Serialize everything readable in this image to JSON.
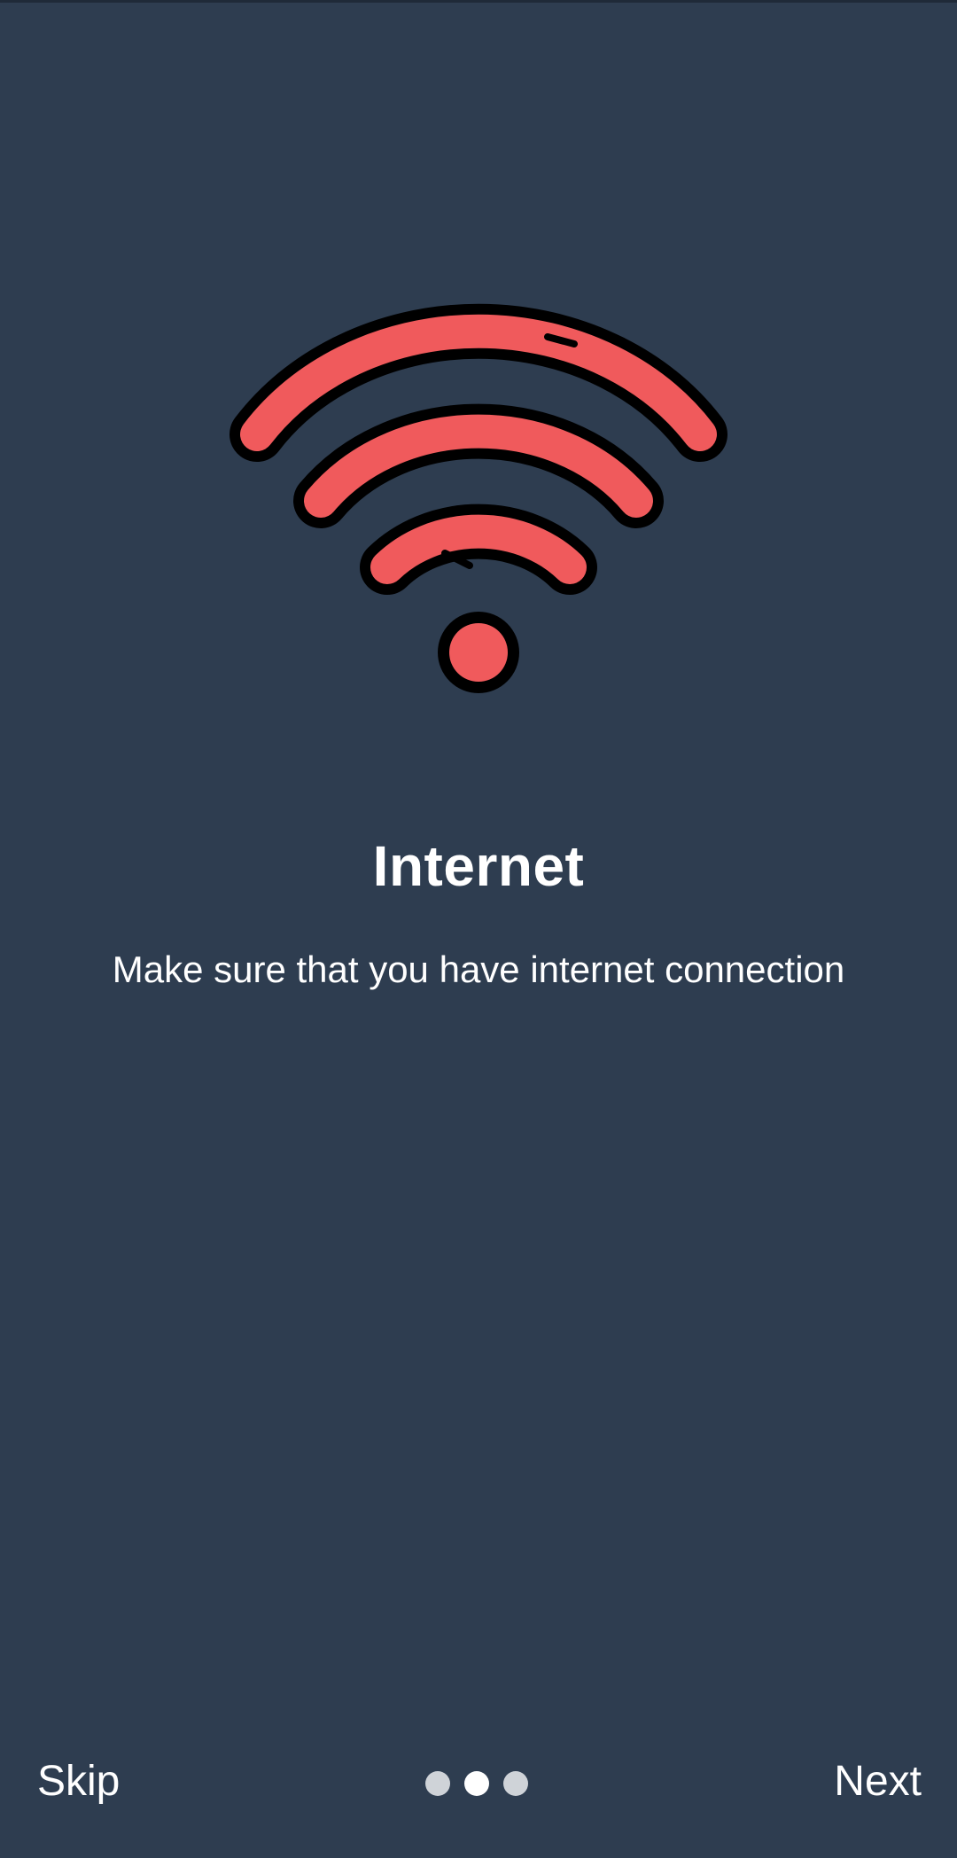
{
  "colors": {
    "background": "#2e3d50",
    "wifi_fill": "#f05a5c",
    "wifi_outline": "#000000",
    "text": "#ffffff",
    "dot_inactive": "#cfd3d8",
    "dot_active": "#ffffff"
  },
  "hero": {
    "icon": "wifi-icon"
  },
  "content": {
    "title": "Internet",
    "subtitle": "Make sure that you have internet connection"
  },
  "navigation": {
    "skip_label": "Skip",
    "next_label": "Next",
    "page_indicator": {
      "total": 3,
      "active_index": 1
    }
  }
}
